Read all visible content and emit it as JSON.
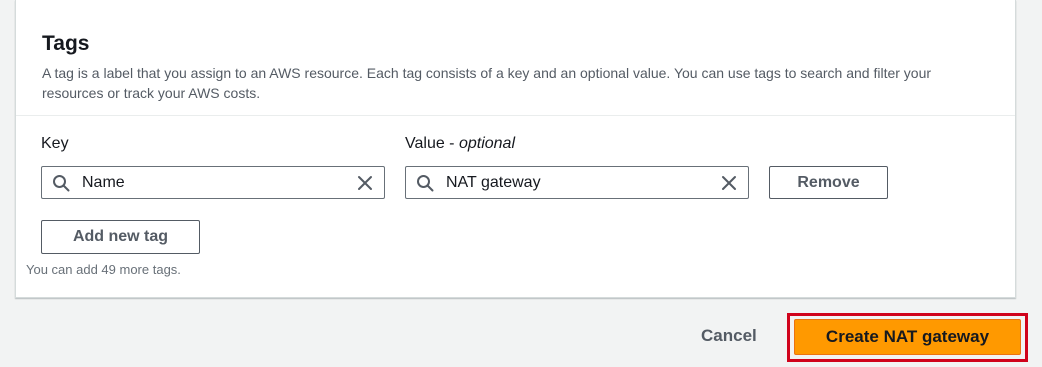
{
  "tags_panel": {
    "title": "Tags",
    "description": "A tag is a label that you assign to an AWS resource. Each tag consists of a key and an optional value. You can use tags to search and filter your resources or track your AWS costs.",
    "key_label": "Key",
    "value_label_prefix": "Value - ",
    "value_label_optional": "optional",
    "tag_rows": [
      {
        "key": "Name",
        "value": "NAT gateway",
        "remove_label": "Remove"
      }
    ],
    "add_tag_label": "Add new tag",
    "remaining_hint": "You can add 49 more tags."
  },
  "footer": {
    "cancel_label": "Cancel",
    "create_label": "Create NAT gateway"
  },
  "icons": {
    "search": "search-icon",
    "clear": "close-icon"
  },
  "colors": {
    "primary_button": "#ff9900",
    "highlight_border": "#d0021b",
    "page_background": "#f2f3f3"
  }
}
